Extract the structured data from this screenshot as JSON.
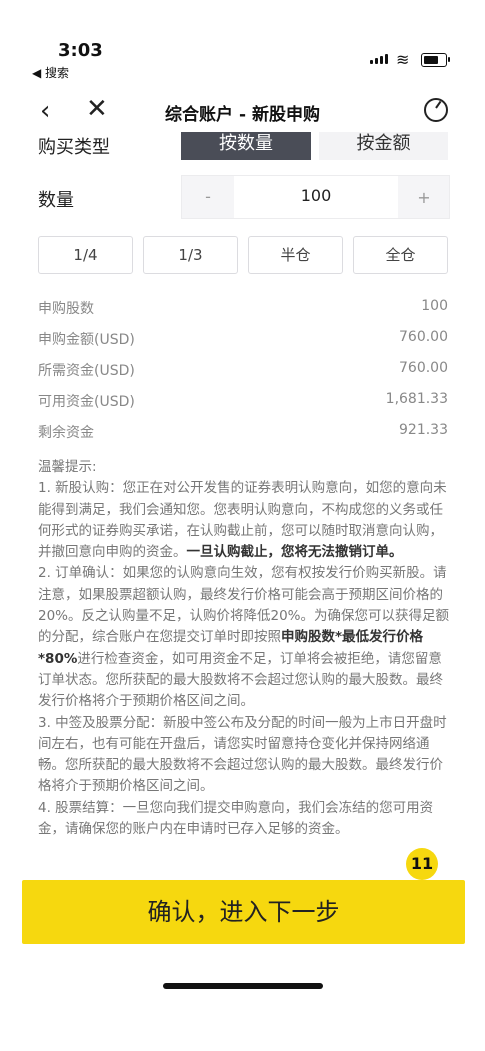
{
  "status_bar": {
    "time": "3:03",
    "back_app": "◀ 搜索"
  },
  "nav": {
    "title": "综合账户 - 新股申购",
    "back_icon": "‹",
    "close_icon": "✕"
  },
  "purchase_type": {
    "label": "购买类型",
    "option_qty": "按数量",
    "option_amount": "按金额"
  },
  "quantity": {
    "label": "数量",
    "minus": "-",
    "value": "100",
    "plus": "+"
  },
  "fractions": [
    "1/4",
    "1/3",
    "半仓",
    "全仓"
  ],
  "summary": [
    {
      "label": "申购股数",
      "value": "100"
    },
    {
      "label": "申购金额(USD)",
      "value": "760.00"
    },
    {
      "label": "所需资金(USD)",
      "value": "760.00"
    },
    {
      "label": "可用资金(USD)",
      "value": "1,681.33"
    },
    {
      "label": "剩余资金",
      "value": "921.33"
    }
  ],
  "notes": {
    "title": "温馨提示:",
    "p1": "1. 新股认购：您正在对公开发售的证券表明认购意向，如您的意向未能得到满足，我们会通知您。您表明认购意向，不构成您的义务或任何形式的证券购买承诺，在认购截止前，您可以随时取消意向认购，并撤回意向申购的资金。",
    "p1_bold": "一旦认购截止，您将无法撤销订单。",
    "p2a": "2. 订单确认：如果您的认购意向生效，您有权按发行价购买新股。请注意，如果股票超额认购，最终发行价格可能会高于预期区间价格的20%。反之认购量不足，认购价将降低20%。为确保您可以获得足额的分配，综合账户在您提交订单时即按照",
    "p2_bold": "申购股数*最低发行价格*80%",
    "p2b": "进行检查资金，如可用资金不足，订单将会被拒绝，请您留意订单状态。您所获配的最大股数将不会超过您认购的最大股数。最终发行价格将介于预期价格区间之间。",
    "p3": "3. 中签及股票分配：新股中签公布及分配的时间一般为上市日开盘时间左右，也有可能在开盘后，请您实时留意持仓变化并保持网络通畅。您所获配的最大股数将不会超过您认购的最大股数。最终发行价格将介于预期价格区间之间。",
    "p4": "4. 股票结算：一旦您向我们提交申购意向，我们会冻结的您可用资金，请确保您的账户内在申请时已存入足够的资金。"
  },
  "confirm_button": "确认，进入下一步",
  "badge": "11"
}
